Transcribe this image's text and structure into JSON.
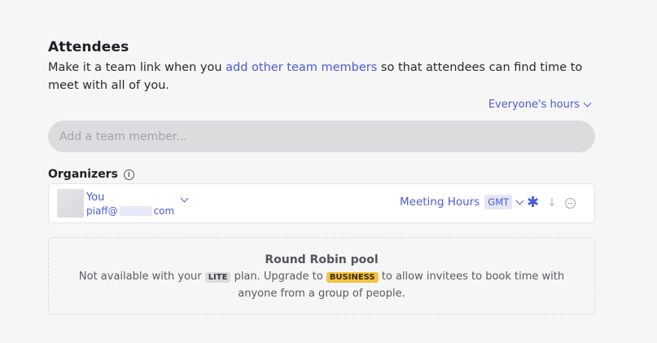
{
  "attendees": {
    "title": "Attendees",
    "desc_before": "Make it a team link when you ",
    "desc_link": "add other team members",
    "desc_after": " so that attendees can find time to meet with all of you.",
    "hours_select": "Everyone's hours"
  },
  "team_input": {
    "placeholder": "Add a team member..."
  },
  "organizers": {
    "label": "Organizers",
    "info_icon": "info-icon",
    "items": [
      {
        "name": "You",
        "email_start": "piaff@",
        "email_end": "com",
        "meeting_hours": "Meeting Hours",
        "timezone": "GMT",
        "icons": [
          "asterisk-icon",
          "arrow-down-icon",
          "remove-icon"
        ]
      }
    ]
  },
  "pool": {
    "title": "Round Robin pool",
    "text_1": "Not available with your ",
    "badge_lite": "LITE",
    "text_2": " plan. Upgrade to ",
    "badge_business": "BUSINESS",
    "text_3": " to allow invitees to book time with anyone from a group of people."
  },
  "colors": {
    "accent": "#4b5bd6",
    "business_badge": "#f5c242"
  }
}
